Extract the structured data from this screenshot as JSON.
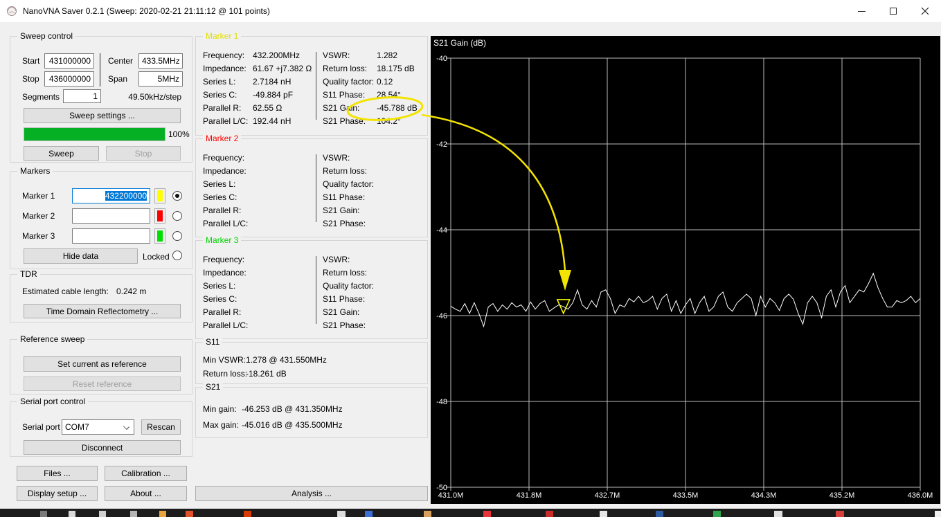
{
  "window": {
    "title": "NanoVNA Saver 0.2.1 (Sweep: 2020-02-21 21:11:12 @ 101 points)"
  },
  "sweep_control": {
    "legend": "Sweep control",
    "start_label": "Start",
    "start_value": "431000000",
    "stop_label": "Stop",
    "stop_value": "436000000",
    "center_label": "Center",
    "center_value": "433.5MHz",
    "span_label": "Span",
    "span_value": "5MHz",
    "segments_label": "Segments",
    "segments_value": "1",
    "step_text": "49.50kHz/step",
    "sweep_settings_button": "Sweep settings ...",
    "progress_percent": "100%",
    "progress_value": 100,
    "sweep_button": "Sweep",
    "stop_button": "Stop"
  },
  "markers_panel": {
    "legend": "Markers",
    "rows": [
      {
        "label": "Marker 1",
        "value": "432200000",
        "color": "#ffff00",
        "selected": true
      },
      {
        "label": "Marker 2",
        "value": "",
        "color": "#ff0000",
        "selected": false
      },
      {
        "label": "Marker 3",
        "value": "",
        "color": "#00e000",
        "selected": false
      }
    ],
    "hide_data_button": "Hide data",
    "locked_label": "Locked"
  },
  "tdr": {
    "legend": "TDR",
    "cable_length_label": "Estimated cable length:",
    "cable_length_value": "0.242 m",
    "button": "Time Domain Reflectometry ..."
  },
  "reference_sweep": {
    "legend": "Reference sweep",
    "set_button": "Set current as reference",
    "reset_button": "Reset reference"
  },
  "serial": {
    "legend": "Serial port control",
    "port_label": "Serial port",
    "port_value": "COM7",
    "rescan_button": "Rescan",
    "disconnect_button": "Disconnect"
  },
  "nav_buttons": {
    "files": "Files ...",
    "calibration": "Calibration ...",
    "display_setup": "Display setup ...",
    "about": "About ...",
    "analysis": "Analysis ..."
  },
  "marker_field_labels": {
    "left": [
      "Frequency:",
      "Impedance:",
      "Series L:",
      "Series C:",
      "Parallel R:",
      "Parallel L/C:"
    ],
    "right": [
      "VSWR:",
      "Return loss:",
      "Quality factor:",
      "S11 Phase:",
      "S21 Gain:",
      "S21 Phase:"
    ]
  },
  "marker_boxes": [
    {
      "title": "Marker 1",
      "title_color": "#e0e000",
      "left_values": [
        "432.200MHz",
        "61.67 +j7.382 Ω",
        "2.7184 nH",
        "-49.884 pF",
        "62.55 Ω",
        "192.44 nH"
      ],
      "right_values": [
        "1.282",
        "18.175 dB",
        "0.12",
        "28.54°",
        "-45.788 dB",
        "104.2°"
      ]
    },
    {
      "title": "Marker 2",
      "title_color": "#ff0000",
      "left_values": [
        "",
        "",
        "",
        "",
        "",
        ""
      ],
      "right_values": [
        "",
        "",
        "",
        "",
        "",
        ""
      ]
    },
    {
      "title": "Marker 3",
      "title_color": "#00d200",
      "left_values": [
        "",
        "",
        "",
        "",
        "",
        ""
      ],
      "right_values": [
        "",
        "",
        "",
        "",
        "",
        ""
      ]
    }
  ],
  "s11_box": {
    "legend": "S11",
    "rows": [
      {
        "label": "Min VSWR:",
        "value": "1.278 @ 431.550MHz"
      },
      {
        "label": "Return loss:",
        "value": "-18.261 dB"
      }
    ]
  },
  "s21_box": {
    "legend": "S21",
    "rows": [
      {
        "label": "Min gain:",
        "value": "-46.253 dB @ 431.350MHz"
      },
      {
        "label": "Max gain:",
        "value": "-45.016 dB @ 435.500MHz"
      }
    ]
  },
  "chart_data": {
    "type": "line",
    "title": "S21 Gain (dB)",
    "xlim_mhz": [
      431.0,
      436.0
    ],
    "ylim": [
      -50,
      -40
    ],
    "x_tick_labels": [
      "431.0M",
      "431.8M",
      "432.7M",
      "433.5M",
      "434.3M",
      "435.2M",
      "436.0M"
    ],
    "y_ticks": [
      -40,
      -42,
      -44,
      -46,
      -48,
      -50
    ],
    "grid": true,
    "background": "#000000",
    "grid_color": "#bdbdbd",
    "text_color": "#ffffff",
    "series": [
      {
        "name": "S21 Gain",
        "color": "#ffffff",
        "x_start_mhz": 431.0,
        "x_step_mhz": 0.05,
        "values": [
          -45.78,
          -45.85,
          -45.9,
          -45.72,
          -45.95,
          -45.7,
          -45.95,
          -46.253,
          -45.8,
          -45.72,
          -45.9,
          -45.75,
          -45.85,
          -45.7,
          -45.8,
          -45.75,
          -45.9,
          -45.68,
          -45.85,
          -45.72,
          -45.65,
          -45.9,
          -45.82,
          -45.75,
          -45.788,
          -45.85,
          -45.7,
          -45.4,
          -45.75,
          -45.85,
          -45.65,
          -45.8,
          -45.45,
          -45.4,
          -45.6,
          -45.95,
          -45.75,
          -45.8,
          -45.6,
          -45.68,
          -45.55,
          -45.7,
          -45.65,
          -45.55,
          -45.85,
          -45.6,
          -45.5,
          -45.9,
          -45.65,
          -45.95,
          -45.75,
          -45.6,
          -45.95,
          -45.7,
          -45.55,
          -45.9,
          -45.8,
          -45.55,
          -45.45,
          -45.8,
          -45.9,
          -45.7,
          -45.6,
          -45.5,
          -45.6,
          -46.0,
          -45.55,
          -45.8,
          -45.6,
          -45.7,
          -45.88,
          -45.6,
          -45.5,
          -45.62,
          -45.95,
          -46.2,
          -45.7,
          -45.55,
          -45.7,
          -46.05,
          -45.55,
          -45.4,
          -45.8,
          -45.45,
          -45.3,
          -45.7,
          -45.55,
          -45.4,
          -45.45,
          -45.25,
          -45.016,
          -45.35,
          -45.6,
          -45.8,
          -45.8,
          -45.65,
          -45.7,
          -45.65,
          -45.55,
          -45.7,
          -45.6
        ]
      }
    ],
    "markers": [
      {
        "name": "Marker 1",
        "x_mhz": 432.2,
        "value_db": -45.788,
        "color": "#ffff00",
        "shape": "triangle-down-open"
      }
    ]
  },
  "annotation": {
    "color": "#f2e400"
  },
  "taskbar": {
    "fragments": [
      [
        58,
        10,
        "#7a7a7a"
      ],
      [
        99,
        10,
        "#d9d9d9"
      ],
      [
        143,
        10,
        "#cfcfcf"
      ],
      [
        188,
        10,
        "#b5b5b5"
      ],
      [
        230,
        10,
        "#e8a33d"
      ],
      [
        268,
        11,
        "#e0502a"
      ],
      [
        352,
        11,
        "#d83b01"
      ],
      [
        487,
        12,
        "#dcdcdc"
      ],
      [
        527,
        11,
        "#3a6fd8"
      ],
      [
        612,
        11,
        "#d8a05c"
      ],
      [
        698,
        11,
        "#e8333a"
      ],
      [
        788,
        11,
        "#c92a2a"
      ],
      [
        866,
        11,
        "#e5e5e5"
      ],
      [
        947,
        11,
        "#2b5aa0"
      ],
      [
        1030,
        11,
        "#2ea44f"
      ],
      [
        1118,
        12,
        "#e0e0e0"
      ],
      [
        1207,
        12,
        "#d43f3a"
      ],
      [
        1350,
        9,
        "#f0f0f0"
      ]
    ]
  }
}
